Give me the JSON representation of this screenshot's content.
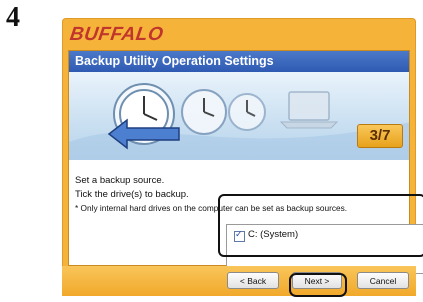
{
  "step_number": "4",
  "brand": "BUFFALO",
  "window": {
    "title": "Backup Utility Operation Settings",
    "step_counter": "3/7"
  },
  "instructions": {
    "line1": "Set a backup source.",
    "line2": "Tick the drive(s) to backup.",
    "line3": "* Only internal hard drives on the computer can be set as backup sources."
  },
  "drives": [
    {
      "label": "C: (System)",
      "checked": true
    }
  ],
  "buttons": {
    "back": "< Back",
    "next": "Next >",
    "cancel": "Cancel"
  }
}
